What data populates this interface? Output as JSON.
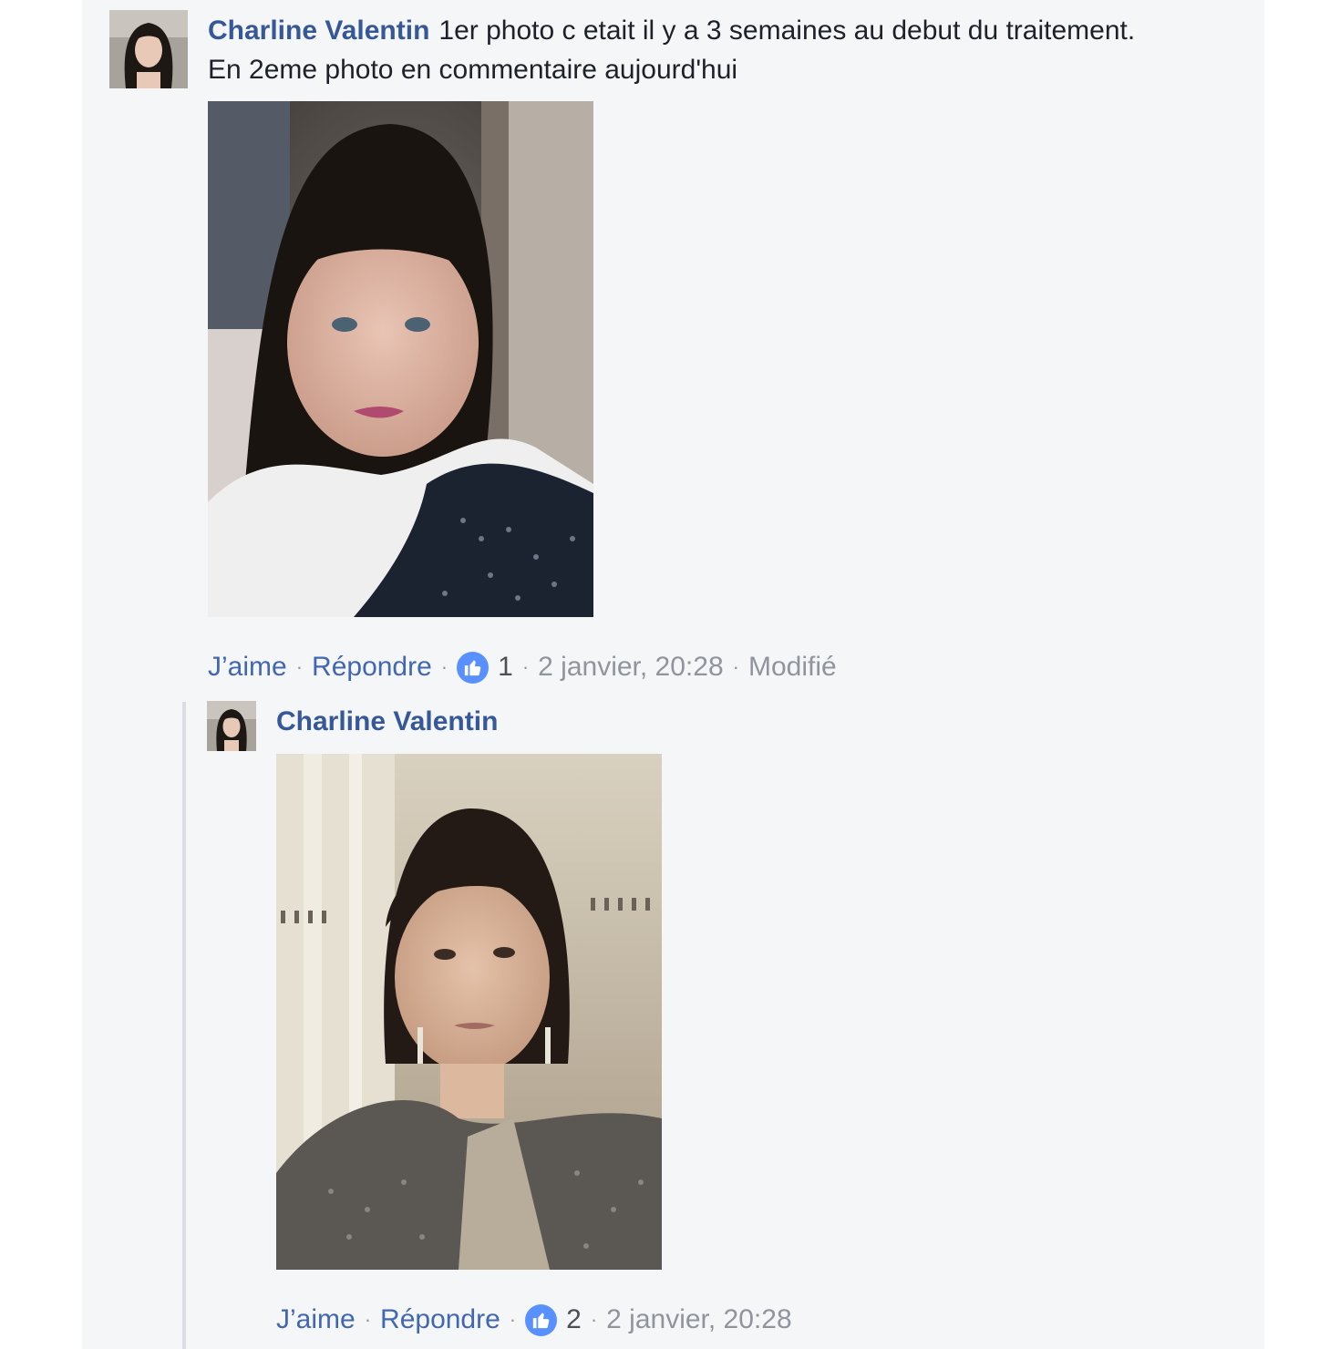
{
  "comment": {
    "author": "Charline Valentin",
    "text_line1": "1er photo c etait il y a 3 semaines au debut du traitement.",
    "text_line2": "En 2eme photo en commentaire aujourd'hui",
    "actions": {
      "like_label": "J’aime",
      "reply_label": "Répondre",
      "reaction_count": "1",
      "timestamp": "2 janvier, 20:28",
      "edited_label": "Modifié"
    }
  },
  "reply": {
    "author": "Charline Valentin",
    "actions": {
      "like_label": "J’aime",
      "reply_label": "Répondre",
      "reaction_count": "2",
      "timestamp": "2 janvier, 20:28"
    }
  },
  "icons": {
    "reaction": "thumbs-up-icon"
  },
  "colors": {
    "link_blue": "#365899",
    "action_blue": "#4267b2",
    "like_badge": "#5890ff",
    "meta_gray": "#90949c",
    "background": "#f5f6f7"
  },
  "separator": "·"
}
